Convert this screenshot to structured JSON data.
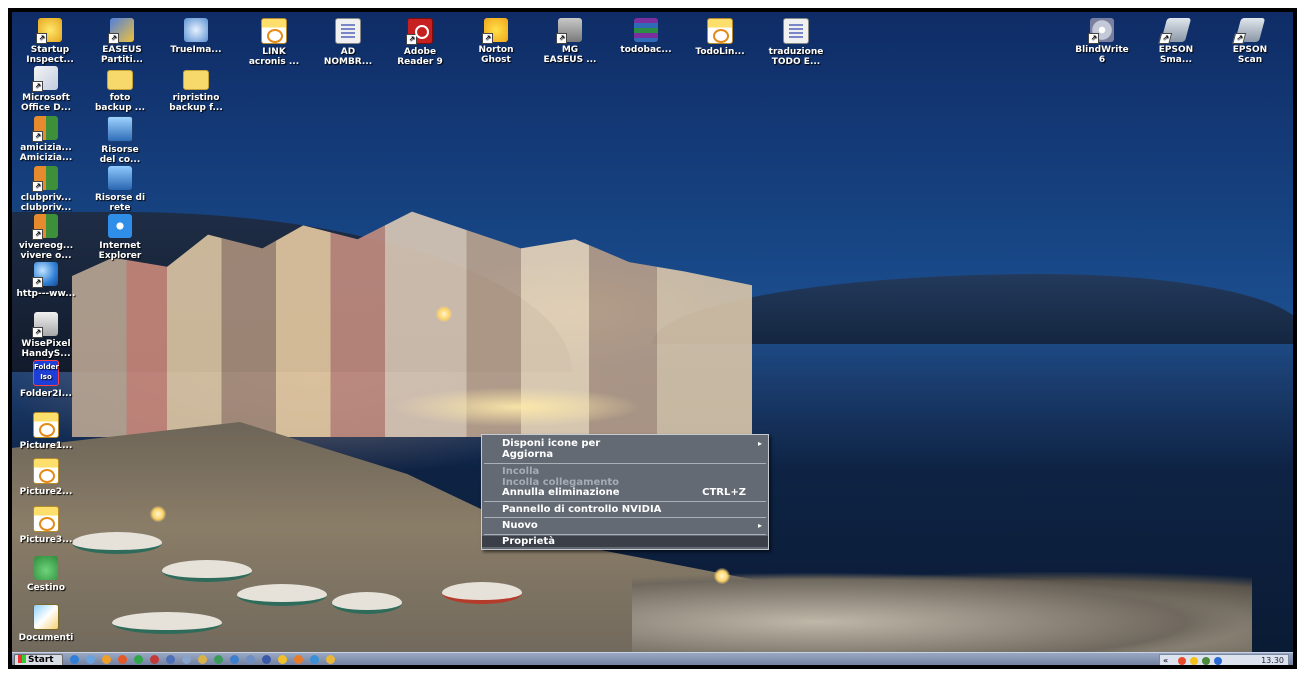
{
  "desktop": {
    "icons_top_row": [
      {
        "label": "Startup\nInspect...",
        "icon": "startup-inspector-icon"
      },
      {
        "label": "EASEUS\nPartiti...",
        "icon": "easeus-partition-icon"
      },
      {
        "label": "TrueIma...",
        "icon": "trueimage-icon"
      },
      {
        "label": "LINK\nacronis ...",
        "icon": "jpg-file-icon"
      },
      {
        "label": "AD\nNOMBR...",
        "icon": "document-icon"
      },
      {
        "label": "Adobe\nReader 9",
        "icon": "adobe-reader-icon"
      },
      {
        "label": "Norton\nGhost",
        "icon": "norton-ghost-icon"
      },
      {
        "label": "MG\nEASEUS ...",
        "icon": "mg-easeus-icon"
      },
      {
        "label": "todobac...",
        "icon": "winrar-icon"
      },
      {
        "label": "TodoLin...",
        "icon": "bmp-file-icon"
      },
      {
        "label": "traduzione\nTODO E...",
        "icon": "text-document-icon"
      }
    ],
    "icons_right": [
      {
        "label": "BlindWrite\n6",
        "icon": "blindwrite-icon"
      },
      {
        "label": "EPSON\nSma...",
        "icon": "epson-smart-panel-icon"
      },
      {
        "label": "EPSON\nScan",
        "icon": "epson-scan-icon"
      }
    ],
    "icons_left": [
      {
        "label": "Microsoft\nOffice D...",
        "icon": "office-document-icon"
      },
      {
        "label": "foto\nbackup ...",
        "icon": "folder-icon"
      },
      {
        "label": "ripristino\nbackup f...",
        "icon": "folder-icon"
      },
      {
        "label": "amicizia...\nAmicizia...",
        "icon": "people-icon"
      },
      {
        "label": "Risorse\ndel co...",
        "icon": "my-computer-icon"
      },
      {
        "label": "clubpriv...\nclubpriv...",
        "icon": "people-icon"
      },
      {
        "label": "Risorse di\nrete",
        "icon": "network-places-icon"
      },
      {
        "label": "vivereog...\nvivere o...",
        "icon": "people-icon"
      },
      {
        "label": "Internet\nExplorer",
        "icon": "internet-explorer-icon"
      },
      {
        "label": "http---ww...",
        "icon": "web-shortcut-icon"
      },
      {
        "label": "WisePixel\nHandyS...",
        "icon": "wisepixel-icon"
      },
      {
        "label": "Folder2I...",
        "icon": "folder2iso-icon",
        "icon_text_1": "Folder",
        "icon_text_2": "Iso"
      },
      {
        "label": "Picture1...",
        "icon": "jpg-file-icon"
      },
      {
        "label": "Picture2...",
        "icon": "jpg-file-icon"
      },
      {
        "label": "Picture3...",
        "icon": "jpg-file-icon"
      },
      {
        "label": "Cestino",
        "icon": "recycle-bin-icon"
      },
      {
        "label": "Documenti",
        "icon": "my-documents-icon"
      }
    ]
  },
  "context_menu": {
    "items": [
      {
        "label": "Disponi icone per",
        "submenu": true,
        "enabled": true
      },
      {
        "label": "Aggiorna",
        "enabled": true
      },
      {
        "label": "Incolla",
        "enabled": false
      },
      {
        "label": "Incolla collegamento",
        "enabled": false
      },
      {
        "label": "Annulla eliminazione",
        "shortcut": "CTRL+Z",
        "enabled": true
      },
      {
        "label": "Pannello di controllo NVIDIA",
        "enabled": true
      },
      {
        "label": "Nuovo",
        "submenu": true,
        "enabled": true
      },
      {
        "label": "Proprietà",
        "enabled": true,
        "highlighted": true
      }
    ],
    "submenu_arrow": "▸"
  },
  "taskbar": {
    "start_label": "Start",
    "tray_chevron": "«",
    "clock": "13.30"
  }
}
